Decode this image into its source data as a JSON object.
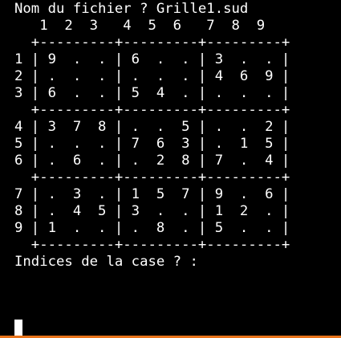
{
  "terminal": {
    "lines": [
      "Nom du fichier ? Grille1.sud",
      "   1  2  3   4  5  6   7  8  9",
      "  +---------+---------+---------+",
      "1 | 9  .  . | 6  .  . | 3  .  . |",
      "2 | .  .  . | .  .  . | 4  6  9 |",
      "3 | 6  .  . | 5  4  . | .  .  . |",
      "  +---------+---------+---------+",
      "4 | 3  7  8 | .  .  5 | .  .  2 |",
      "5 | .  .  . | 7  6  3 | .  1  5 |",
      "6 | .  6  . | .  2  8 | 7  .  4 |",
      "  +---------+---------+---------+",
      "7 | .  3  . | 1  5  7 | 9  .  6 |",
      "8 | .  4  5 | 3  .  . | 1  2  . |",
      "9 | 1  .  . | .  8  . | 5  .  . |",
      "  +---------+---------+---------+",
      "Indices de la case ? :"
    ]
  },
  "colors": {
    "background": "#000000",
    "foreground": "#ffffff",
    "bottom_accent": "#e8731a"
  }
}
